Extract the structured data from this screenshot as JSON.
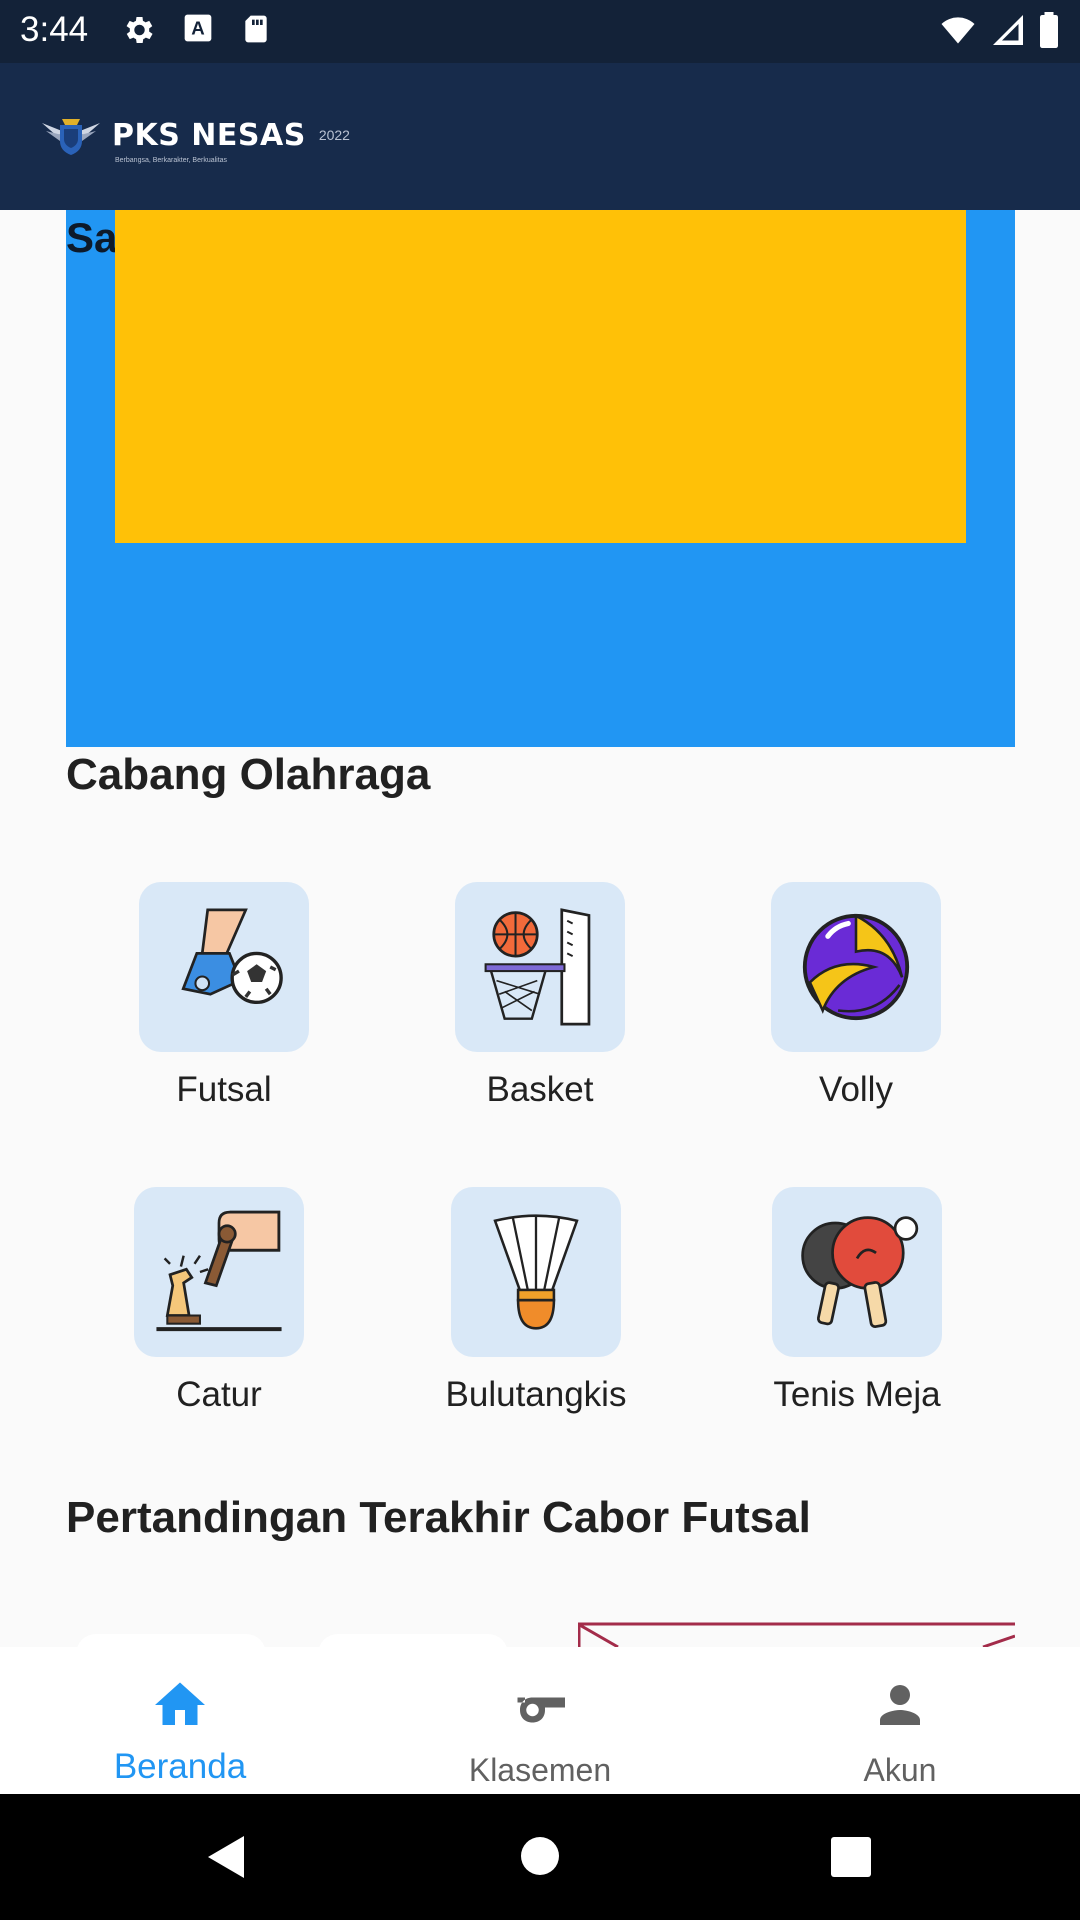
{
  "status_bar": {
    "time": "3:44",
    "icons_left": [
      "gear-icon",
      "font-a-icon",
      "sd-card-icon"
    ],
    "icons_right": [
      "wifi-icon",
      "signal-icon",
      "battery-icon"
    ]
  },
  "app_bar": {
    "logo_title": "PKS NESAS",
    "logo_year": "2022",
    "logo_subtitle": "Berbangsa, Berkarakter, Berkualitas"
  },
  "banner": {
    "title_partial": "Sa",
    "colors": {
      "outer": "#2196f3",
      "inner": "#ffc107"
    }
  },
  "sports_section": {
    "title": "Cabang Olahraga",
    "items": [
      {
        "label": "Futsal",
        "icon": "futsal-icon"
      },
      {
        "label": "Basket",
        "icon": "basketball-icon"
      },
      {
        "label": "Volly",
        "icon": "volleyball-icon"
      },
      {
        "label": "Catur",
        "icon": "chess-icon"
      },
      {
        "label": "Bulutangkis",
        "icon": "shuttlecock-icon"
      },
      {
        "label": "Tenis Meja",
        "icon": "table-tennis-icon"
      }
    ]
  },
  "matches_section": {
    "title": "Pertandingan Terakhir Cabor Futsal"
  },
  "bottom_nav": {
    "items": [
      {
        "label": "Beranda",
        "icon": "home-icon",
        "active": true
      },
      {
        "label": "Klasemen",
        "icon": "whistle-icon",
        "active": false
      },
      {
        "label": "Akun",
        "icon": "person-icon",
        "active": false
      }
    ],
    "active_color": "#2196f3",
    "inactive_color": "#616161"
  },
  "system_nav": {
    "buttons": [
      "back-icon",
      "home-circle-icon",
      "recents-icon"
    ]
  }
}
